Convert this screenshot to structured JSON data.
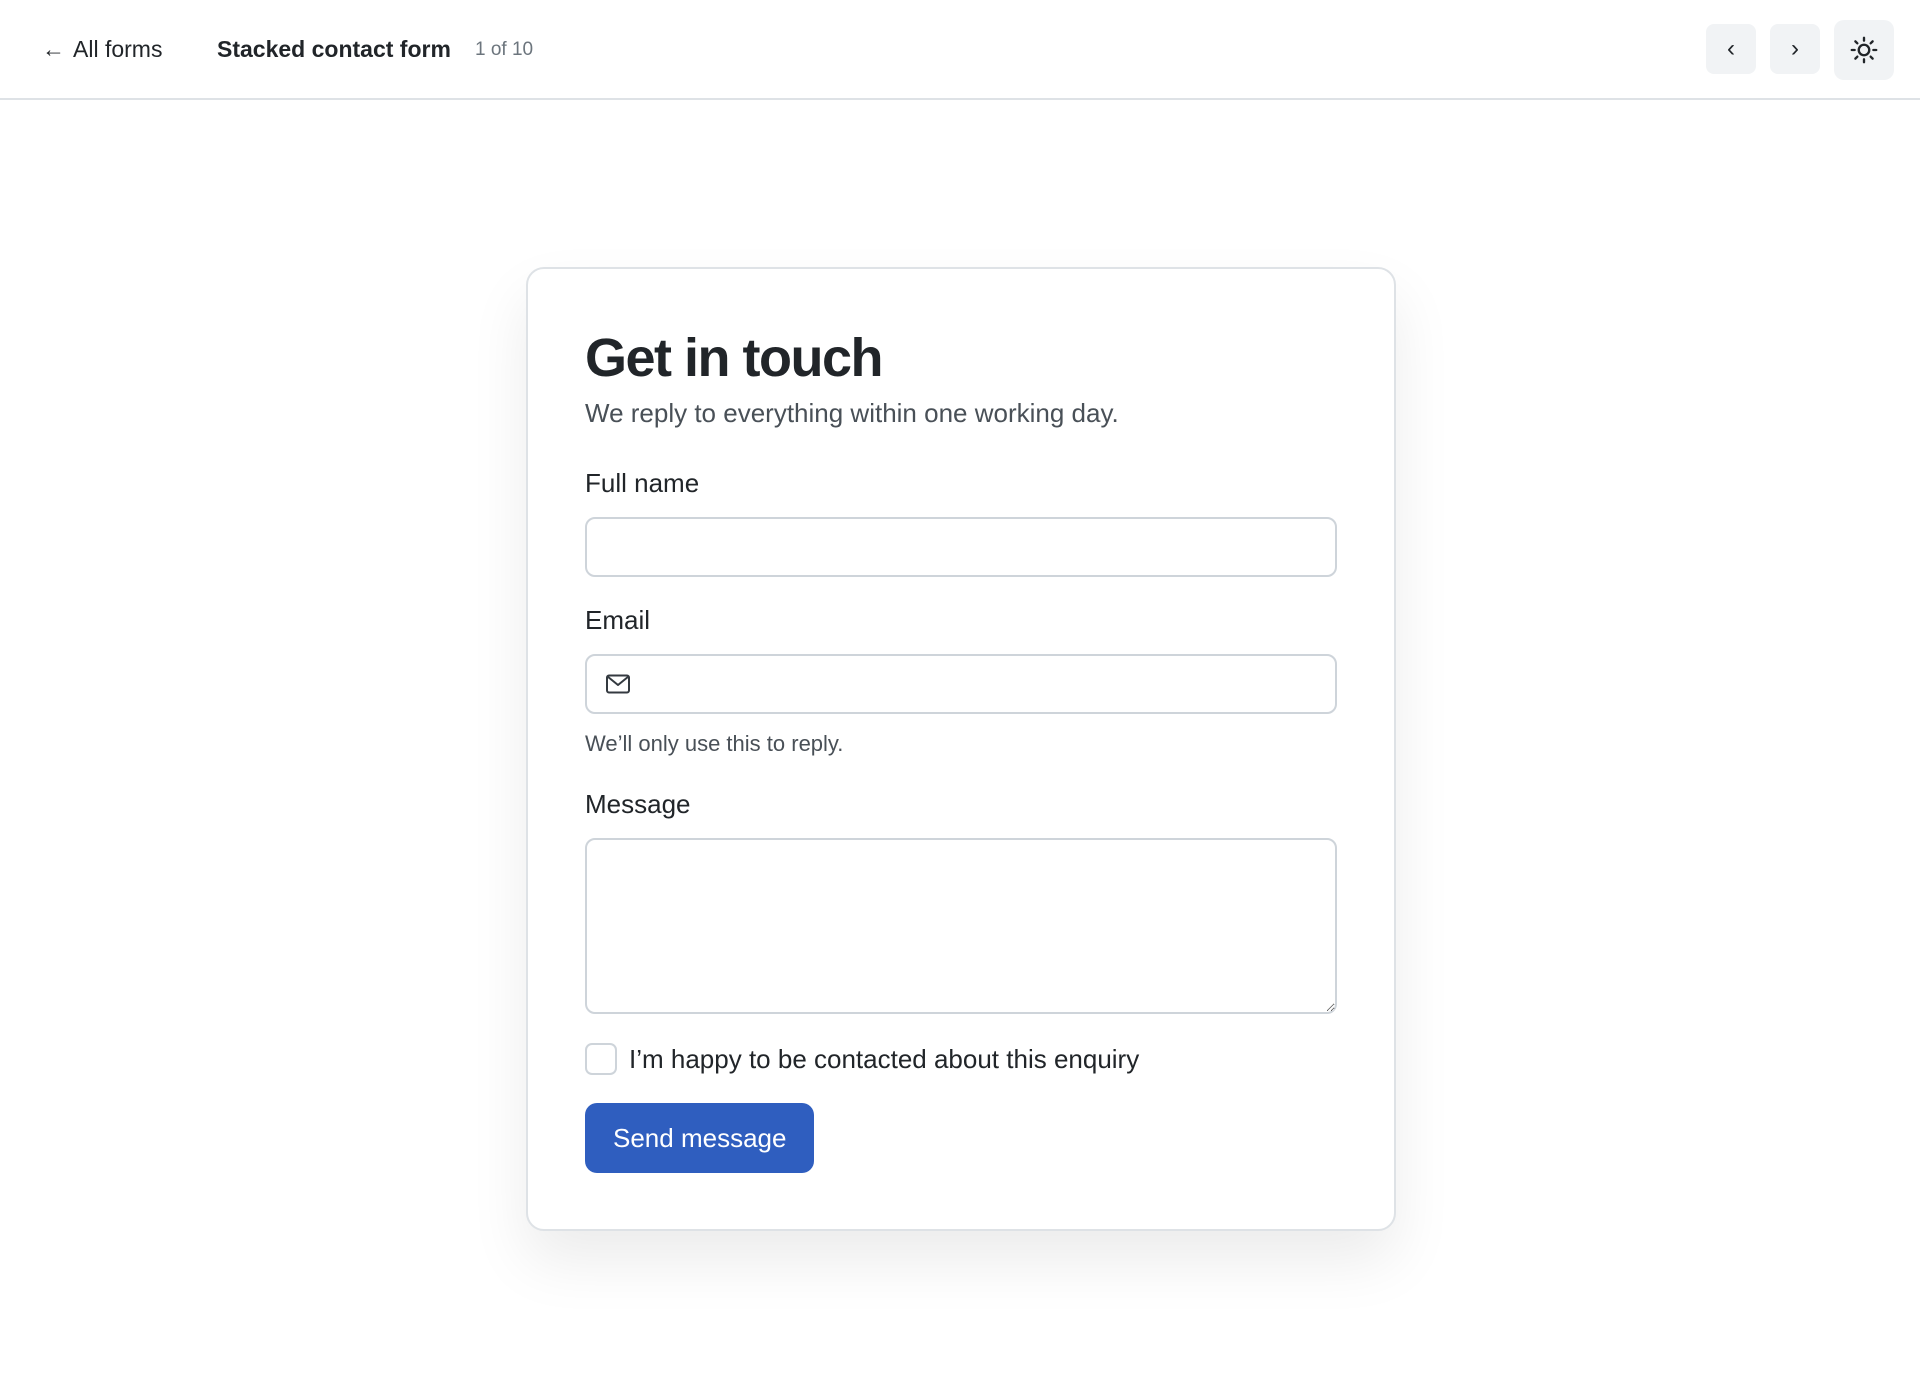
{
  "topbar": {
    "back_arrow": "←",
    "back_label": "All forms",
    "title": "Stacked contact form",
    "count": "1 of 10",
    "prev_label": "‹",
    "next_label": "›",
    "theme_icon": "sun-icon"
  },
  "form": {
    "heading": "Get in touch",
    "subheading": "We reply to everything within one working day.",
    "fields": {
      "name": {
        "label": "Full name",
        "value": "",
        "placeholder": ""
      },
      "email": {
        "label": "Email",
        "value": "",
        "placeholder": "",
        "icon": "mail-icon",
        "help": "We’ll only use this to reply."
      },
      "message": {
        "label": "Message",
        "value": "",
        "placeholder": ""
      }
    },
    "consent": {
      "label": "I’m happy to be contacted about this enquiry",
      "checked": false
    },
    "submit_label": "Send message"
  },
  "colors": {
    "accent": "#2f5ebf",
    "border": "#ced4da",
    "text": "#212529",
    "muted": "#495057"
  }
}
